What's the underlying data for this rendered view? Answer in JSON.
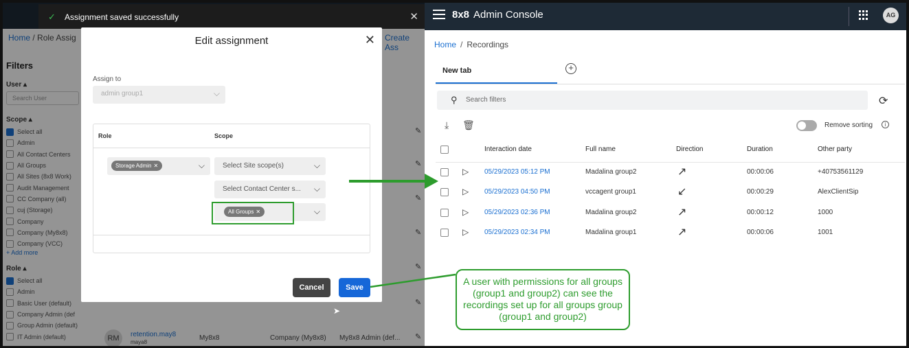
{
  "toast": {
    "message": "Assignment saved successfully"
  },
  "left_bg": {
    "crumb_home": "Home",
    "crumb_current": "/ Role Assig",
    "create": "Create Ass",
    "filters_title": "Filters",
    "user_head": "User",
    "search_user": "Search User",
    "scope_head": "Scope",
    "scope_items": [
      "Select all",
      "Admin",
      "All Contact Centers",
      "All Groups",
      "All Sites (8x8 Work)",
      "Audit Management",
      "CC Company (all)",
      "cuj (Storage)",
      "Company",
      "Company (My8x8)",
      "Company (VCC)"
    ],
    "add_more": "+ Add more",
    "role_head": "Role",
    "role_items": [
      "Select all",
      "Admin",
      "Basic User (default)",
      "Company Admin (def",
      "Group Admin (default)",
      "IT Admin (default)"
    ],
    "row_initials": "RM",
    "row_name": "retention.may8",
    "row_sub": "maya8",
    "row_col2": "My8x8",
    "row_col3": "Company (My8x8)",
    "row_col4": "My8x8 Admin (def..."
  },
  "modal": {
    "title": "Edit assignment",
    "assign_label": "Assign to",
    "assign_value": "admin group1",
    "col_role": "Role",
    "col_scope": "Scope",
    "role_chip": "Storage Admin",
    "scope_site": "Select Site scope(s)",
    "scope_cc": "Select Contact Center s...",
    "scope_group_chip": "All Groups",
    "cancel": "Cancel",
    "save": "Save"
  },
  "console": {
    "brand_bold": "8x8",
    "brand_rest": "Admin Console",
    "avatar": "AG",
    "crumb_home": "Home",
    "crumb_sep": "/",
    "crumb_current": "Recordings",
    "tab": "New tab",
    "search_placeholder": "Search filters",
    "remove_sorting": "Remove sorting",
    "columns": [
      "Interaction date",
      "Full name",
      "Direction",
      "Duration",
      "Other party"
    ],
    "rows": [
      {
        "date": "05/29/2023 05:12 PM",
        "name": "Madalina group2",
        "direction": "outgoing",
        "duration": "00:00:06",
        "other": "+40753561129"
      },
      {
        "date": "05/29/2023 04:50 PM",
        "name": "vccagent group1",
        "direction": "incoming",
        "duration": "00:00:29",
        "other": "AlexClientSip"
      },
      {
        "date": "05/29/2023 02:36 PM",
        "name": "Madalina group2",
        "direction": "outgoing",
        "duration": "00:00:12",
        "other": "1000"
      },
      {
        "date": "05/29/2023 02:34 PM",
        "name": "Madalina group1",
        "direction": "outgoing",
        "duration": "00:00:06",
        "other": "1001"
      }
    ]
  },
  "callout": {
    "text": "A user with permissions for all groups (group1 and group2) can see the recordings set up for all groups group (group1 and group2)"
  },
  "colors": {
    "accent": "#1a6fd1",
    "annotation": "#2d9c2d",
    "topbar": "#1e2a36"
  }
}
